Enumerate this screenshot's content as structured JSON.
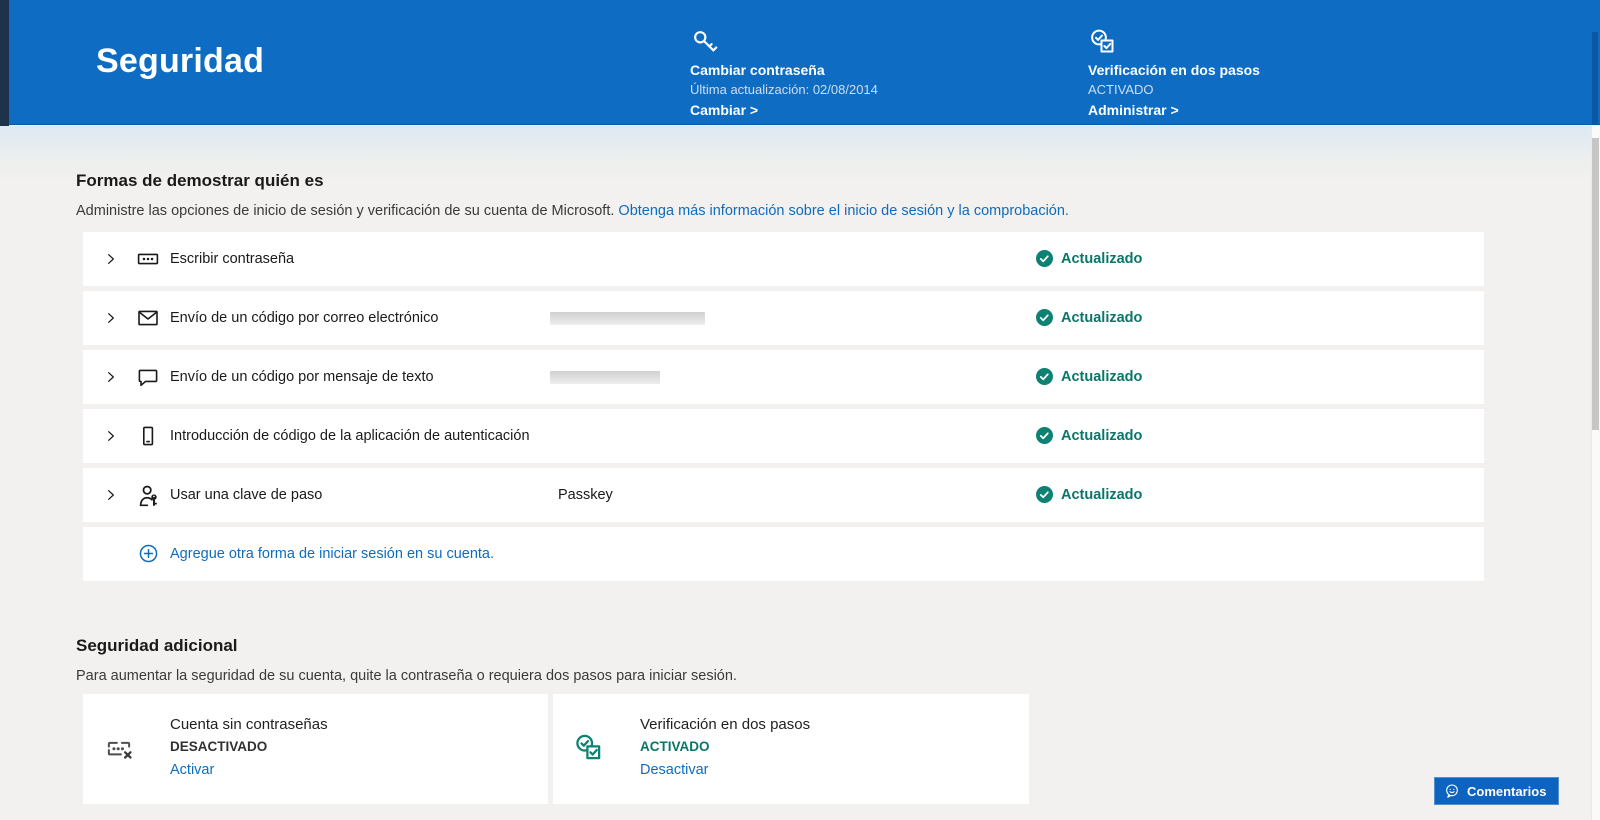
{
  "header": {
    "title": "Seguridad",
    "password_card": {
      "icon": "key-icon",
      "title": "Cambiar contraseña",
      "subtitle": "Última actualización: 02/08/2014",
      "action": "Cambiar >"
    },
    "twostep_card": {
      "icon": "two-step-check-icon",
      "title": "Verificación en dos pasos",
      "subtitle": "ACTIVADO",
      "action": "Administrar >"
    }
  },
  "signin_section": {
    "heading": "Formas de demostrar quién es",
    "description": "Administre las opciones de inicio de sesión y verificación de su cuenta de Microsoft.",
    "description_link": "Obtenga más información sobre el inicio de sesión y la comprobación.",
    "rows": [
      {
        "icon": "password-icon",
        "label": "Escribir contraseña",
        "value": "",
        "redacted": false,
        "status": "Actualizado"
      },
      {
        "icon": "mail-icon",
        "label": "Envío de un código por correo electrónico",
        "value": "",
        "redacted": true,
        "status": "Actualizado"
      },
      {
        "icon": "chat-icon",
        "label": "Envío de un código por mensaje de texto",
        "value": "",
        "redacted": true,
        "status": "Actualizado"
      },
      {
        "icon": "phone-icon",
        "label": "Introducción de código de la aplicación de autenticación",
        "value": "",
        "redacted": false,
        "status": "Actualizado"
      },
      {
        "icon": "person-key-icon",
        "label": "Usar una clave de paso",
        "value": "Passkey",
        "redacted": false,
        "status": "Actualizado"
      }
    ],
    "status_icon": "check-circle-icon",
    "add_link": "Agregue otra forma de iniciar sesión en su cuenta.",
    "add_icon": "plus-circle-icon"
  },
  "additional_section": {
    "heading": "Seguridad adicional",
    "description": "Para aumentar la seguridad de su cuenta, quite la contraseña o requiera dos pasos para iniciar sesión.",
    "cards": [
      {
        "icon": "passwordless-x-icon",
        "title": "Cuenta sin contraseñas",
        "status": "DESACTIVADO",
        "action": "Activar"
      },
      {
        "icon": "two-step-check-icon",
        "title": "Verificación en dos pasos",
        "status": "ACTIVADO",
        "action": "Desactivar"
      }
    ]
  },
  "feedback_button": {
    "icon": "chat-smile-icon",
    "label": "Comentarios"
  },
  "colors": {
    "header_blue": "#0e6cc3",
    "link_blue": "#0f6cbd",
    "status_teal": "#0a766a",
    "status_circle_teal": "#0e8272",
    "background": "#f2f1ef"
  }
}
